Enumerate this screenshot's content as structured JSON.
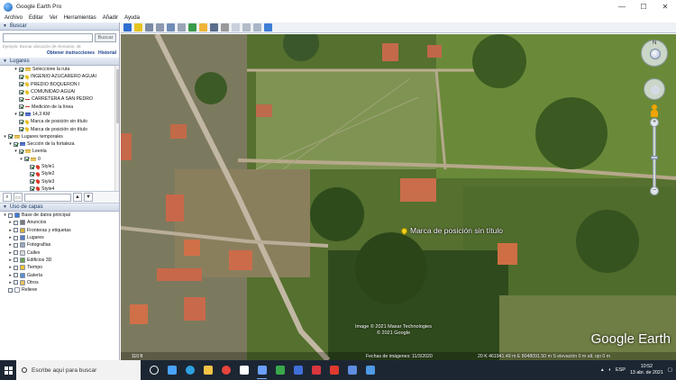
{
  "window": {
    "title": "Google Earth Pro",
    "controls": [
      "—",
      "☐",
      "✕"
    ]
  },
  "menu": [
    "Archivo",
    "Editar",
    "Ver",
    "Herramientas",
    "Añadir",
    "Ayuda"
  ],
  "search": {
    "header": "Buscar",
    "placeholder": "",
    "button": "Buscar",
    "hint": "Ejemplo: Buscar ubicación de Alemania, 48",
    "link_instructions": "Obtener instrucciones",
    "link_history": "Historial"
  },
  "places": {
    "header": "Lugares",
    "items": [
      {
        "label": "Seleccione la ruta",
        "icon": "folder",
        "checked": true,
        "indent": 2
      },
      {
        "label": "INGENIO AZUCARERO AGUAI",
        "icon": "pin-yellow",
        "checked": true,
        "indent": 2
      },
      {
        "label": "PREDIO BOQUERON I",
        "icon": "pin-yellow",
        "checked": true,
        "indent": 2
      },
      {
        "label": "COMUNIDAD AGUAI",
        "icon": "pin-yellow",
        "checked": true,
        "indent": 2
      },
      {
        "label": "CARRETERA A SAN PEDRO",
        "icon": "line",
        "checked": true,
        "indent": 2
      },
      {
        "label": "Medición de la línea",
        "icon": "line",
        "checked": true,
        "indent": 2
      },
      {
        "label": "14,3 KM",
        "icon": "folder-blue",
        "checked": true,
        "indent": 2
      },
      {
        "label": "Marca de posición sin título",
        "icon": "pin-yellow",
        "checked": true,
        "indent": 2
      },
      {
        "label": "Marca de posición sin título",
        "icon": "pin-yellow",
        "checked": true,
        "indent": 2
      },
      {
        "label": "Lugares temporales",
        "icon": "folder",
        "checked": true,
        "indent": 0
      },
      {
        "label": "Sección de la fortaleza",
        "icon": "folder-blue",
        "checked": true,
        "indent": 1
      },
      {
        "label": "Leenla",
        "icon": "folder",
        "checked": true,
        "indent": 2
      },
      {
        "label": "0",
        "icon": "folder",
        "checked": true,
        "indent": 3
      },
      {
        "label": "Style1",
        "icon": "pin-red",
        "checked": true,
        "indent": 4
      },
      {
        "label": "Style2",
        "icon": "pin-red",
        "checked": true,
        "indent": 4
      },
      {
        "label": "Style3",
        "icon": "pin-red",
        "checked": true,
        "indent": 4
      },
      {
        "label": "Style4",
        "icon": "pin-red",
        "checked": true,
        "indent": 4
      },
      {
        "label": "Marca de posición sin título",
        "icon": "pin-yellow",
        "checked": true,
        "indent": 3,
        "selected": true
      }
    ]
  },
  "layers": {
    "header": "Uso de capas",
    "items": [
      {
        "label": "Base de datos principal",
        "icon": "#3b7bd6",
        "indent": 0
      },
      {
        "label": "Anuncios",
        "icon": "#7a7a7a",
        "indent": 1
      },
      {
        "label": "Fronteras y etiquetas",
        "icon": "#d2b03a",
        "indent": 1
      },
      {
        "label": "Lugares",
        "icon": "#5b7bc4",
        "indent": 1
      },
      {
        "label": "Fotografías",
        "icon": "#9aa7b8",
        "indent": 1
      },
      {
        "label": "Calles",
        "icon": "#d9d9d9",
        "indent": 1
      },
      {
        "label": "Edificios 3D",
        "icon": "#6da34d",
        "indent": 1
      },
      {
        "label": "Tiempo",
        "icon": "#f2c230",
        "indent": 1
      },
      {
        "label": "Galería",
        "icon": "#5a8fd1",
        "indent": 1
      },
      {
        "label": "Otros",
        "icon": "#e8c25e",
        "indent": 1
      },
      {
        "label": "Relieve",
        "icon": "#ffffff",
        "indent": 0
      }
    ]
  },
  "map": {
    "placemark_label": "Marca de posición sin título",
    "credit_line1": "Image © 2021 Maxar Technologies",
    "credit_line2": "© 2021 Google",
    "logo": "Google Earth",
    "imagery_date": "Fechas de imágenes: 11/3/2020",
    "coordinates": "20 K 461941.49 m E 8048091.50 m S elevación   0 m   alt. ojo   0 m",
    "scale": "110 ft",
    "compass_letter": "N"
  },
  "taskbar": {
    "search_text": "Escribe aquí para buscar",
    "time": "10:52",
    "date": "13 abr. de 2021",
    "lang": "ESP",
    "apps": [
      "task-view",
      "widgets",
      "edge",
      "explorer",
      "chrome",
      "store",
      "google-earth",
      "app-green",
      "app-blue",
      "app-red",
      "acrobat",
      "photos",
      "app-blue2"
    ]
  }
}
